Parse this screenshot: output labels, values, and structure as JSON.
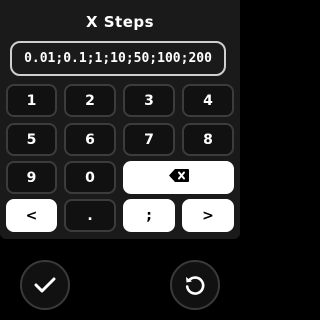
{
  "title": "X Steps",
  "input": {
    "value": "0.01;0.1;1;10;50;100;200"
  },
  "keys": {
    "k1": "1",
    "k2": "2",
    "k3": "3",
    "k4": "4",
    "k5": "5",
    "k6": "6",
    "k7": "7",
    "k8": "8",
    "k9": "9",
    "k0": "0",
    "dot": ".",
    "semicolon": ";",
    "left": "<",
    "right": ">"
  },
  "icons": {
    "backspace": "backspace-icon",
    "confirm": "checkmark-icon",
    "reset": "reset-icon"
  },
  "colors": {
    "panel": "#1a1a1a",
    "key_border": "#3c3c3c",
    "highlight": "#ffffff"
  }
}
